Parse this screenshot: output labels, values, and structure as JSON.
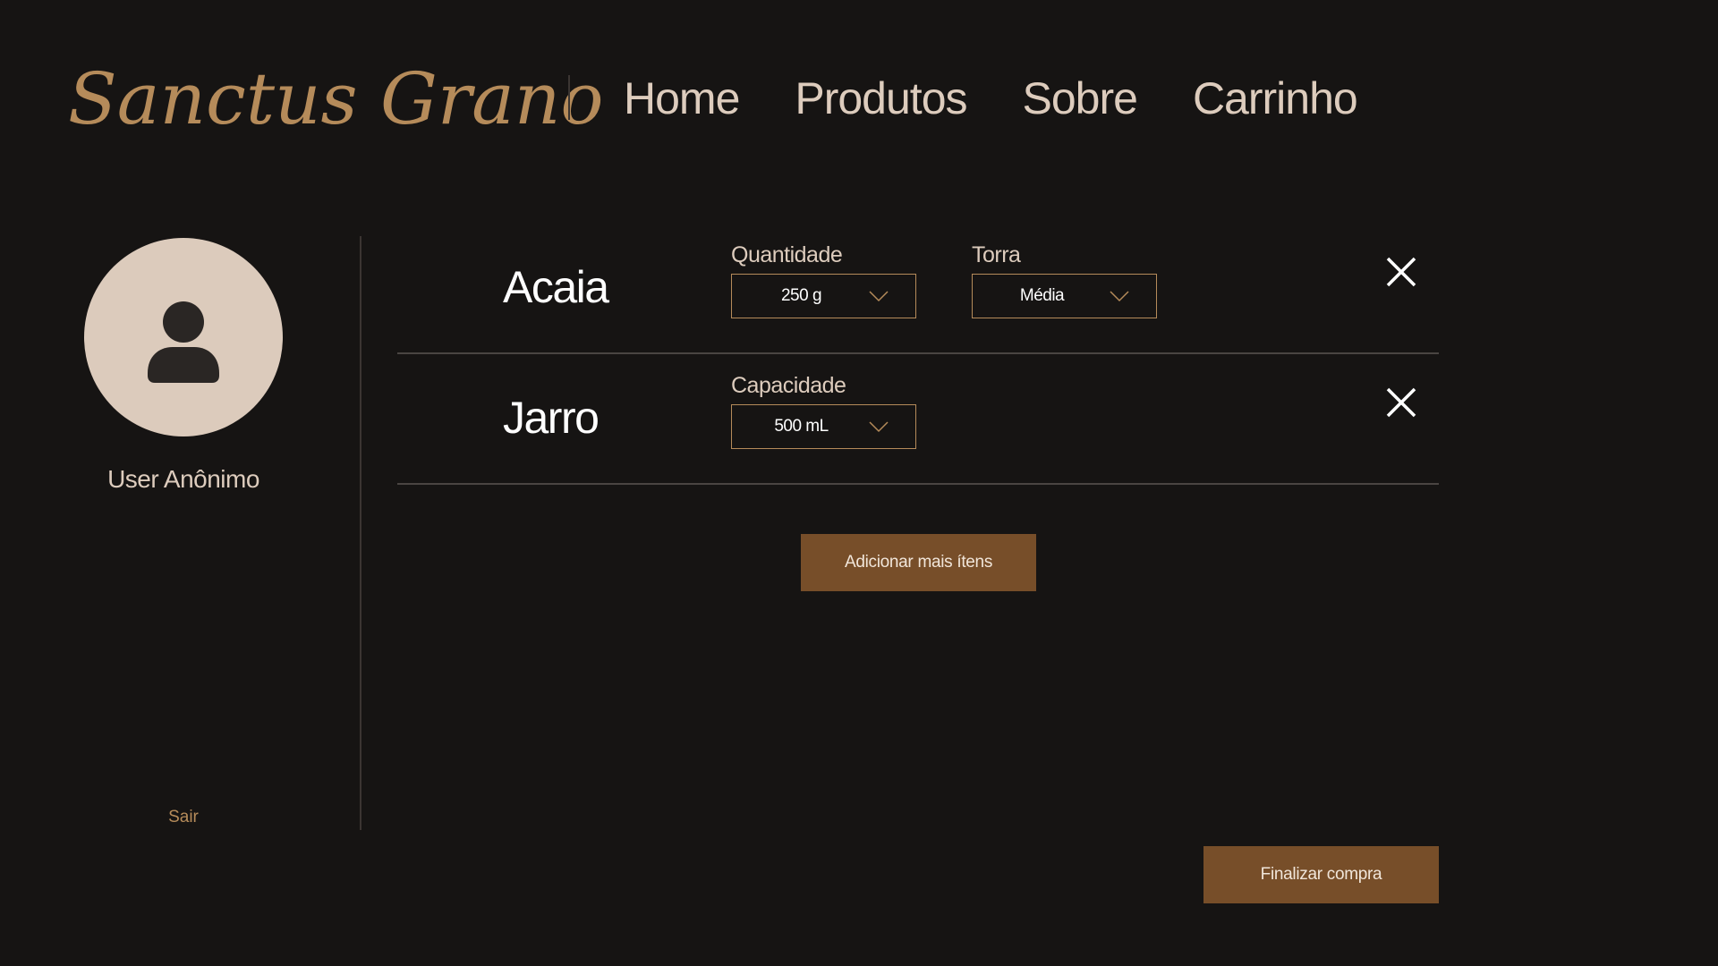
{
  "header": {
    "logo": "Sanctus Grano",
    "nav": [
      "Home",
      "Produtos",
      "Sobre",
      "Carrinho"
    ]
  },
  "sidebar": {
    "avatar_icon": "user-icon",
    "user_name": "User Anônimo",
    "logout_label": "Sair"
  },
  "cart": {
    "items": [
      {
        "name": "Acaia",
        "options": [
          {
            "label": "Quantidade",
            "value": "250 g"
          },
          {
            "label": "Torra",
            "value": "Média"
          }
        ]
      },
      {
        "name": "Jarro",
        "options": [
          {
            "label": "Capacidade",
            "value": "500 mL"
          }
        ]
      }
    ],
    "add_more_label": "Adicionar mais ítens",
    "checkout_label": "Finalizar compra"
  },
  "colors": {
    "background": "#161413",
    "brand": "#b58b5a",
    "button": "#774e29",
    "text": "#ddccbd"
  }
}
